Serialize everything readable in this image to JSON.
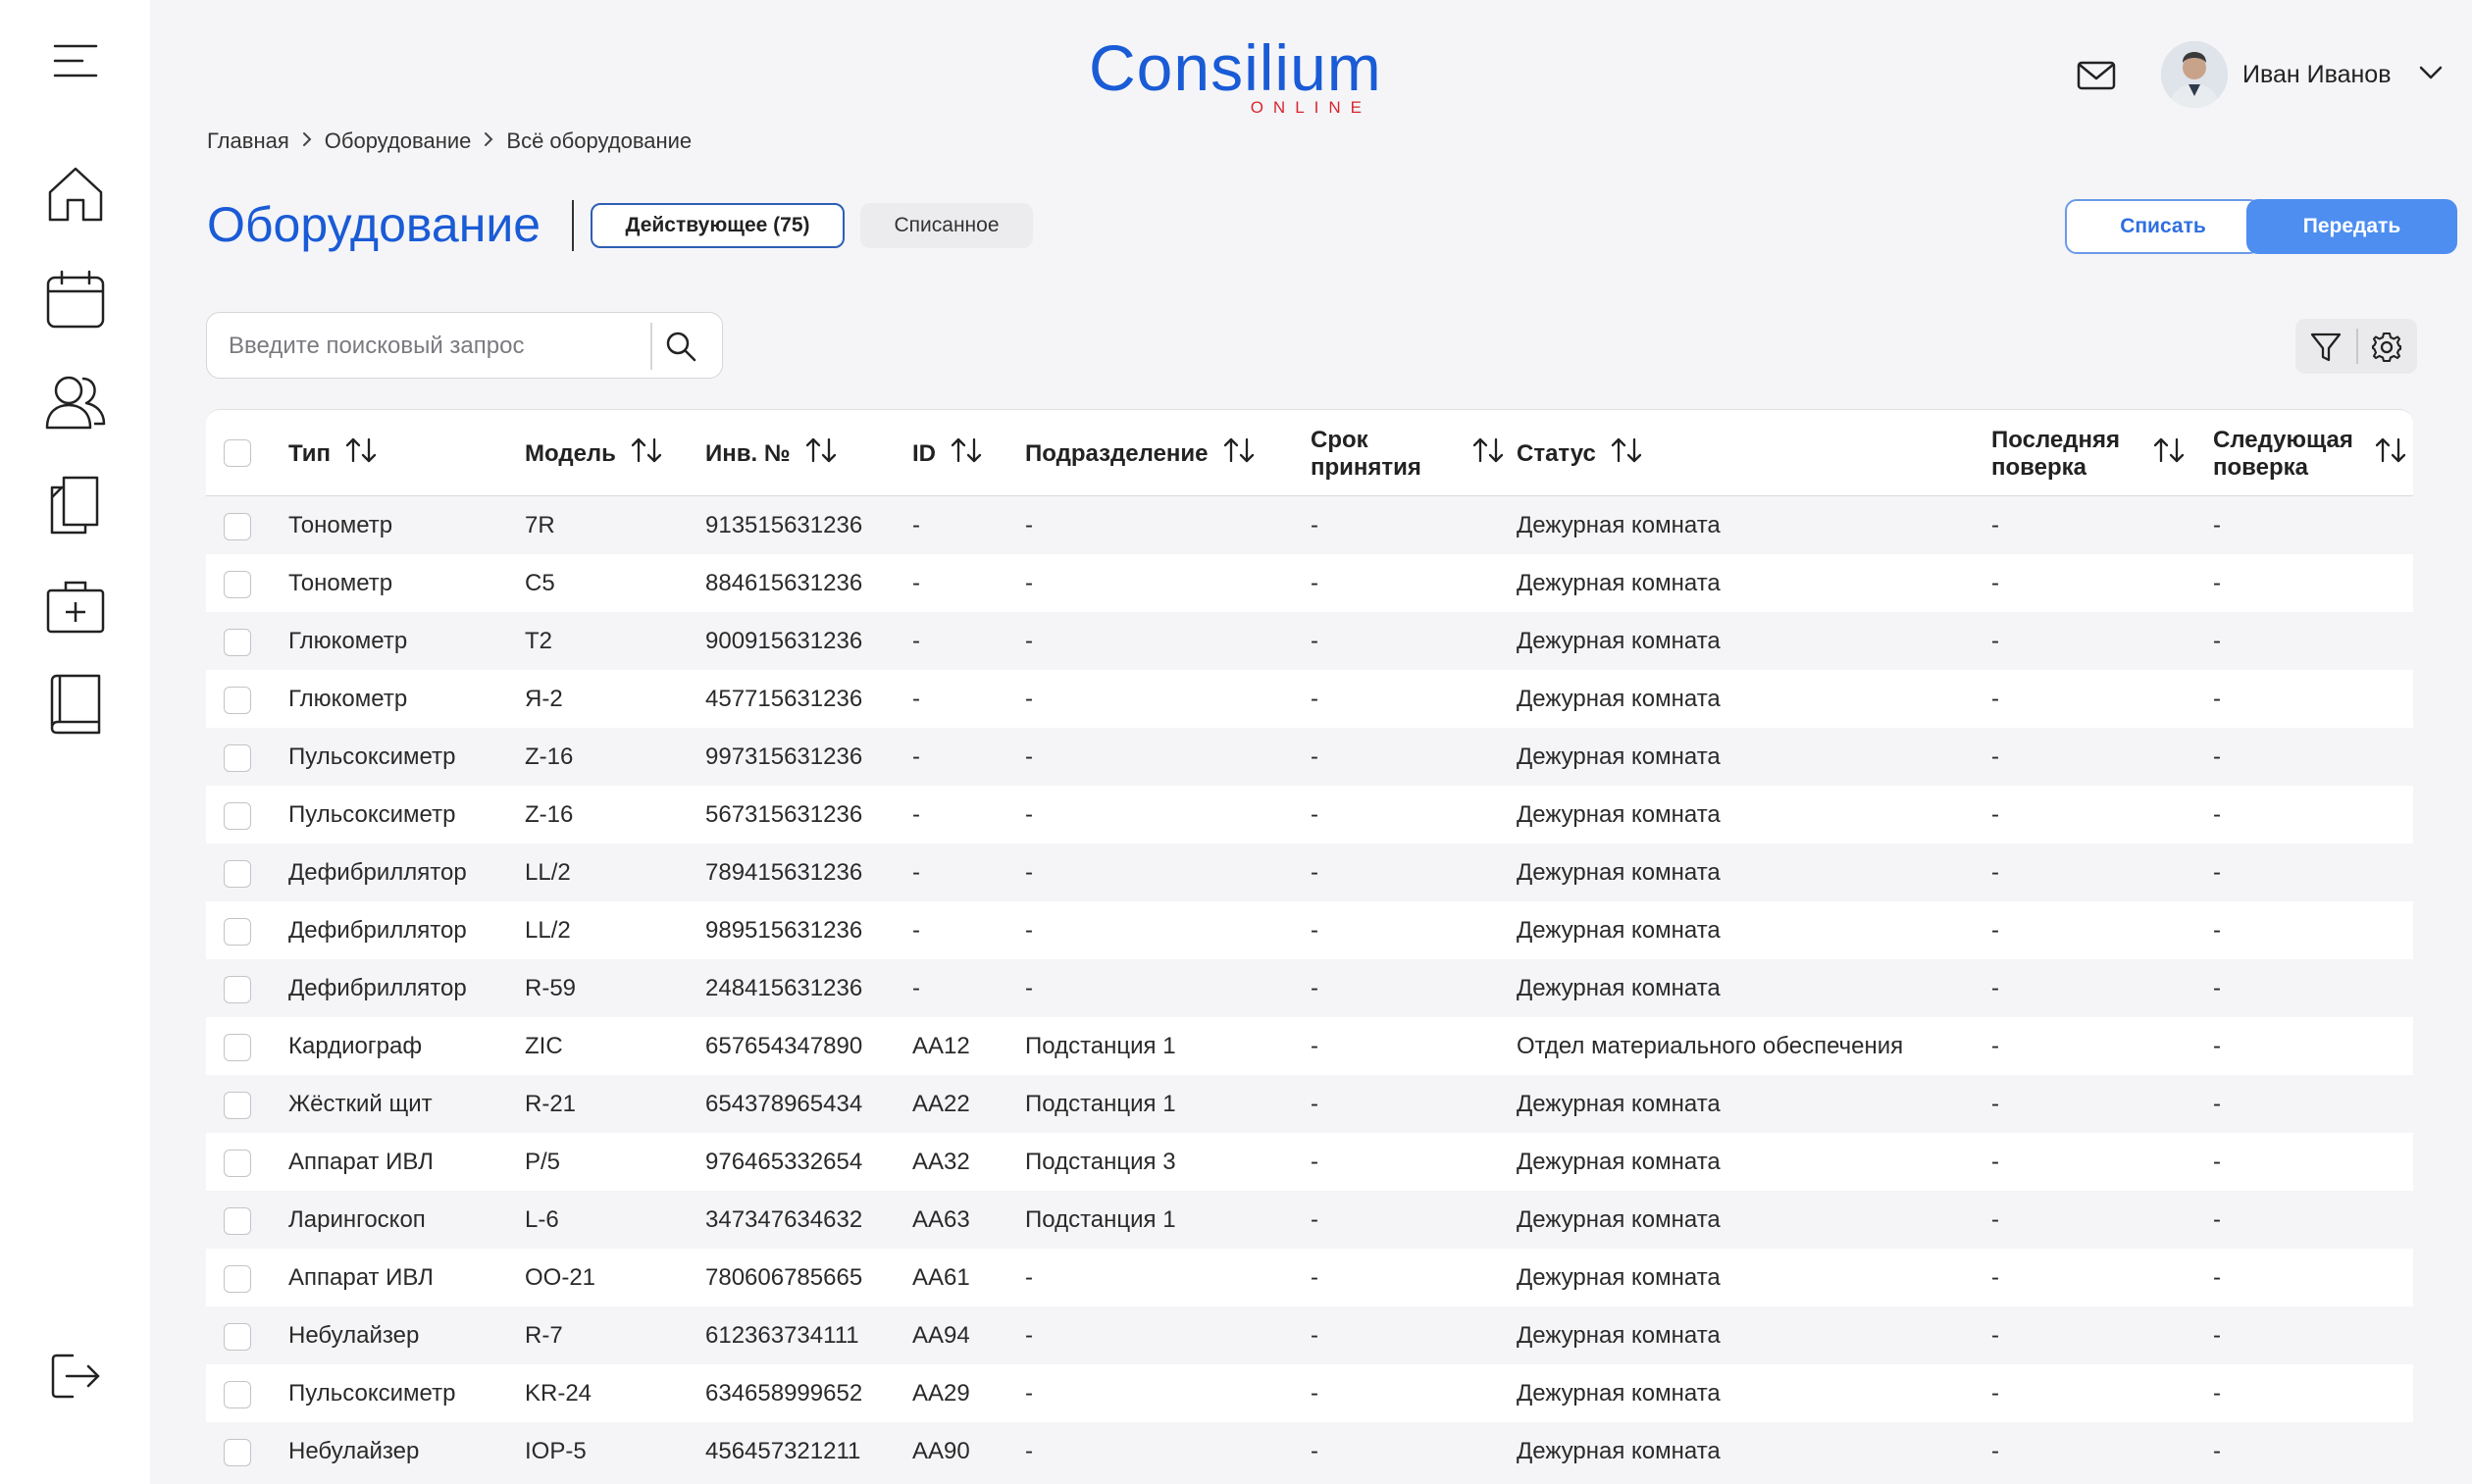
{
  "app": {
    "logo_text": "Consilium",
    "logo_sub": "ONLINE"
  },
  "user": {
    "name": "Иван Иванов"
  },
  "breadcrumb": [
    "Главная",
    "Оборудование",
    "Всё оборудование"
  ],
  "page": {
    "title": "Оборудование",
    "tabs": [
      {
        "label": "Действующее (75)",
        "active": true
      },
      {
        "label": "Списанное",
        "active": false
      }
    ],
    "actions": {
      "writeoff": "Списать",
      "transfer": "Передать"
    }
  },
  "search": {
    "placeholder": "Введите поисковый запрос",
    "value": ""
  },
  "sidebar": {
    "items": [
      "menu-icon",
      "home-icon",
      "calendar-icon",
      "users-icon",
      "documents-icon",
      "medkit-icon",
      "book-icon",
      "logout-icon"
    ]
  },
  "table": {
    "columns": [
      {
        "label": "Тип"
      },
      {
        "label": "Модель"
      },
      {
        "label": "Инв. №"
      },
      {
        "label": "ID"
      },
      {
        "label": "Подразделение"
      },
      {
        "label": "Срок принятия"
      },
      {
        "label": "Статус"
      },
      {
        "label": "Последняя поверка"
      },
      {
        "label": "Следующая поверка"
      }
    ],
    "rows": [
      [
        "Тонометр",
        "7R",
        "913515631236",
        "-",
        "-",
        "-",
        "Дежурная комната",
        "-",
        "-"
      ],
      [
        "Тонометр",
        "C5",
        "884615631236",
        "-",
        "-",
        "-",
        "Дежурная комната",
        "-",
        "-"
      ],
      [
        "Глюкометр",
        "T2",
        "900915631236",
        "-",
        "-",
        "-",
        "Дежурная комната",
        "-",
        "-"
      ],
      [
        "Глюкометр",
        "Я-2",
        "457715631236",
        "-",
        "-",
        "-",
        "Дежурная комната",
        "-",
        "-"
      ],
      [
        "Пульсоксиметр",
        "Z-16",
        "997315631236",
        "-",
        "-",
        "-",
        "Дежурная комната",
        "-",
        "-"
      ],
      [
        "Пульсоксиметр",
        "Z-16",
        "567315631236",
        "-",
        "-",
        "-",
        "Дежурная комната",
        "-",
        "-"
      ],
      [
        "Дефибриллятор",
        "LL/2",
        "789415631236",
        "-",
        "-",
        "-",
        "Дежурная комната",
        "-",
        "-"
      ],
      [
        "Дефибриллятор",
        "LL/2",
        "989515631236",
        "-",
        "-",
        "-",
        "Дежурная комната",
        "-",
        "-"
      ],
      [
        "Дефибриллятор",
        "R-59",
        "248415631236",
        "-",
        "-",
        "-",
        "Дежурная комната",
        "-",
        "-"
      ],
      [
        "Кардиограф",
        "ZIC",
        "657654347890",
        "AA12",
        "Подстанция 1",
        "-",
        "Отдел материального обеспечения",
        "-",
        "-"
      ],
      [
        "Жёсткий щит",
        "R-21",
        "654378965434",
        "AA22",
        "Подстанция 1",
        "-",
        "Дежурная комната",
        "-",
        "-"
      ],
      [
        "Аппарат ИВЛ",
        "P/5",
        "976465332654",
        "AA32",
        "Подстанция 3",
        "-",
        "Дежурная комната",
        "-",
        "-"
      ],
      [
        "Ларингоскоп",
        "L-6",
        "347347634632",
        "AA63",
        "Подстанция 1",
        "-",
        "Дежурная комната",
        "-",
        "-"
      ],
      [
        "Аппарат ИВЛ",
        "OO-21",
        "780606785665",
        "AA61",
        "-",
        "-",
        "Дежурная комната",
        "-",
        "-"
      ],
      [
        "Небулайзер",
        "R-7",
        "612363734111",
        "AA94",
        "-",
        "-",
        "Дежурная комната",
        "-",
        "-"
      ],
      [
        "Пульсоксиметр",
        "KR-24",
        "634658999652",
        "AA29",
        "-",
        "-",
        "Дежурная комната",
        "-",
        "-"
      ],
      [
        "Небулайзер",
        "IOP-5",
        "456457321211",
        "AA90",
        "-",
        "-",
        "Дежурная комната",
        "-",
        "-"
      ]
    ]
  },
  "colors": {
    "accent": "#1a5bd6",
    "logo_red": "#d8262d",
    "primary_button": "#4d8ef0",
    "background": "#f5f5f7"
  }
}
